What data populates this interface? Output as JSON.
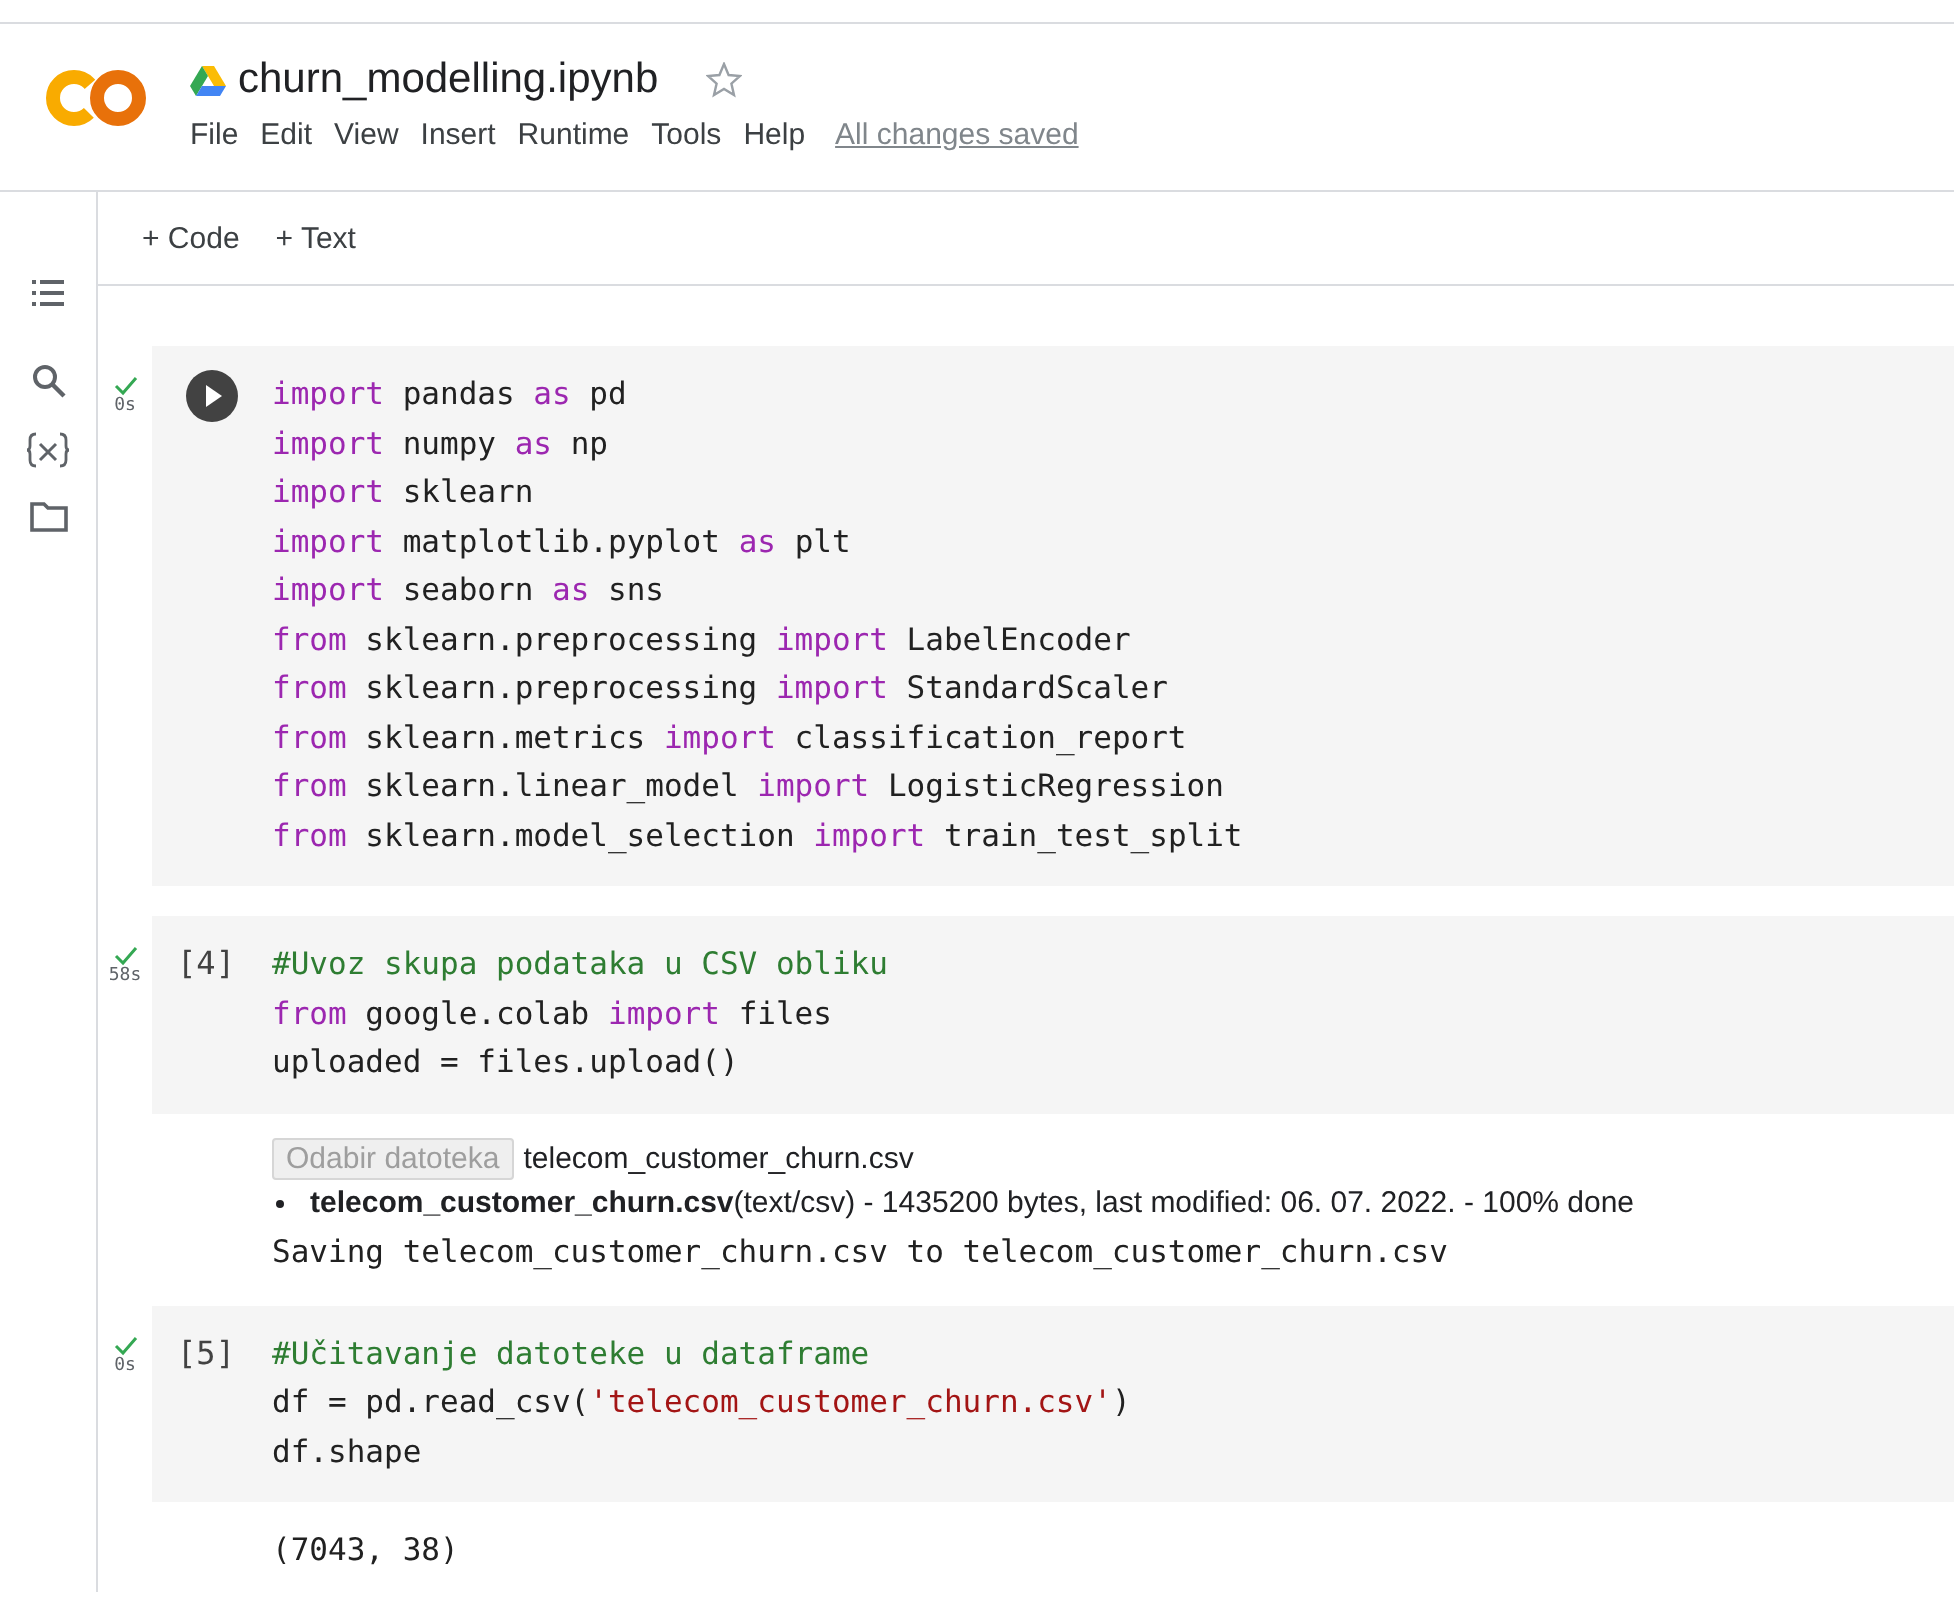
{
  "notebook": {
    "title": "churn_modelling.ipynb",
    "starred": false
  },
  "menu": [
    {
      "label": "File"
    },
    {
      "label": "Edit"
    },
    {
      "label": "View"
    },
    {
      "label": "Insert"
    },
    {
      "label": "Runtime"
    },
    {
      "label": "Tools"
    },
    {
      "label": "Help"
    }
  ],
  "save_status": "All changes saved",
  "toolbar": [
    {
      "label": "+ Code"
    },
    {
      "label": "+ Text"
    }
  ],
  "cells": [
    {
      "succeeded": true,
      "time": "0s",
      "prompt": {
        "kind": "run_button"
      },
      "lines": [
        [
          {
            "kind": "keyword",
            "text": "import"
          },
          {
            "kind": "plain",
            "text": " pandas "
          },
          {
            "kind": "keyword",
            "text": "as"
          },
          {
            "kind": "plain",
            "text": " pd"
          }
        ],
        [
          {
            "kind": "keyword",
            "text": "import"
          },
          {
            "kind": "plain",
            "text": " numpy "
          },
          {
            "kind": "keyword",
            "text": "as"
          },
          {
            "kind": "plain",
            "text": " np"
          }
        ],
        [
          {
            "kind": "keyword",
            "text": "import"
          },
          {
            "kind": "plain",
            "text": " sklearn"
          }
        ],
        [
          {
            "kind": "keyword",
            "text": "import"
          },
          {
            "kind": "plain",
            "text": " matplotlib.pyplot "
          },
          {
            "kind": "keyword",
            "text": "as"
          },
          {
            "kind": "plain",
            "text": " plt"
          }
        ],
        [
          {
            "kind": "keyword",
            "text": "import"
          },
          {
            "kind": "plain",
            "text": " seaborn "
          },
          {
            "kind": "keyword",
            "text": "as"
          },
          {
            "kind": "plain",
            "text": " sns"
          }
        ],
        [
          {
            "kind": "keyword",
            "text": "from"
          },
          {
            "kind": "plain",
            "text": " sklearn.preprocessing "
          },
          {
            "kind": "keyword",
            "text": "import"
          },
          {
            "kind": "plain",
            "text": " LabelEncoder"
          }
        ],
        [
          {
            "kind": "keyword",
            "text": "from"
          },
          {
            "kind": "plain",
            "text": " sklearn.preprocessing "
          },
          {
            "kind": "keyword",
            "text": "import"
          },
          {
            "kind": "plain",
            "text": " StandardScaler"
          }
        ],
        [
          {
            "kind": "keyword",
            "text": "from"
          },
          {
            "kind": "plain",
            "text": " sklearn.metrics "
          },
          {
            "kind": "keyword",
            "text": "import"
          },
          {
            "kind": "plain",
            "text": " classification_report"
          }
        ],
        [
          {
            "kind": "keyword",
            "text": "from"
          },
          {
            "kind": "plain",
            "text": " sklearn.linear_model "
          },
          {
            "kind": "keyword",
            "text": "import"
          },
          {
            "kind": "plain",
            "text": " LogisticRegression"
          }
        ],
        [
          {
            "kind": "keyword",
            "text": "from"
          },
          {
            "kind": "plain",
            "text": " sklearn.model_selection "
          },
          {
            "kind": "keyword",
            "text": "import"
          },
          {
            "kind": "plain",
            "text": " train_test_split"
          }
        ]
      ]
    },
    {
      "succeeded": true,
      "time": "58s",
      "prompt": {
        "kind": "count",
        "text": "[4]"
      },
      "lines": [
        [
          {
            "kind": "comment",
            "text": "#Uvoz skupa podataka u CSV obliku"
          }
        ],
        [
          {
            "kind": "keyword",
            "text": "from"
          },
          {
            "kind": "plain",
            "text": " google.colab "
          },
          {
            "kind": "keyword",
            "text": "import"
          },
          {
            "kind": "plain",
            "text": " files"
          }
        ],
        [
          {
            "kind": "plain",
            "text": "uploaded = files.upload()"
          }
        ]
      ],
      "outputs": [
        {
          "kind": "upload",
          "button": "Odabir datoteka",
          "file_name": "telecom_customer_churn.csv",
          "items": [
            "**telecom_customer_churn.csv**(text/csv) - 1435200 bytes, last modified: 06. 07. 2022. - 100% done"
          ]
        },
        {
          "kind": "stream",
          "text": "Saving telecom_customer_churn.csv to telecom_customer_churn.csv"
        }
      ]
    },
    {
      "succeeded": true,
      "time": "0s",
      "prompt": {
        "kind": "count",
        "text": "[5]"
      },
      "lines": [
        [
          {
            "kind": "comment",
            "text": "#Učitavanje datoteke u dataframe"
          }
        ],
        [
          {
            "kind": "plain",
            "text": "df = pd.read_csv("
          },
          {
            "kind": "string",
            "text": "'telecom_customer_churn.csv'"
          },
          {
            "kind": "plain",
            "text": ")"
          }
        ],
        [
          {
            "kind": "plain",
            "text": "df.shape"
          }
        ]
      ],
      "outputs": [
        {
          "kind": "stream",
          "text": "(7043, 38)"
        }
      ]
    }
  ]
}
